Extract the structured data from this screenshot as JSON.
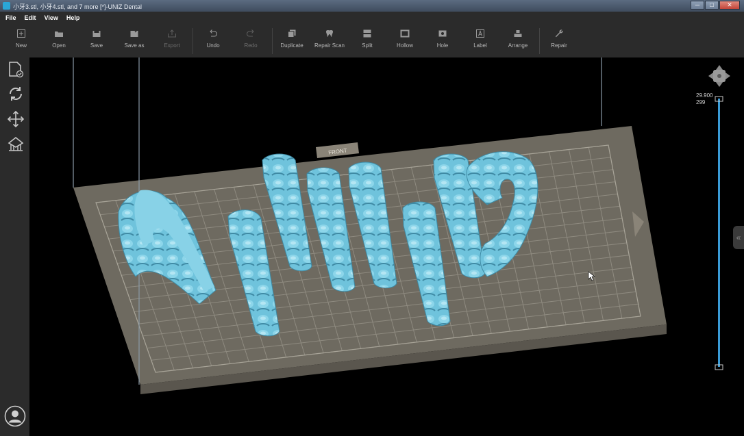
{
  "window": {
    "title": "小牙3.stl, 小牙4.stl, and 7 more [*]-UNIZ Dental",
    "minimize": "─",
    "maximize": "□",
    "close": "✕"
  },
  "menu": [
    "File",
    "Edit",
    "View",
    "Help"
  ],
  "toolbar": {
    "new": "New",
    "open": "Open",
    "save": "Save",
    "save_as": "Save as",
    "export": "Export",
    "undo": "Undo",
    "redo": "Redo",
    "duplicate": "Duplicate",
    "repair_scan": "Repair Scan",
    "split": "Split",
    "hollow": "Hollow",
    "hole": "Hole",
    "label": "Label",
    "arrange": "Arrange",
    "repair": "Repair"
  },
  "viewport": {
    "front_label": "FRONT",
    "layer_height": "29.900",
    "layer_index": "299",
    "collapse_glyph": "«",
    "model_color": "#6fc3dc",
    "plate_color": "#6e6a60",
    "slider_color": "#3a9bd6"
  }
}
